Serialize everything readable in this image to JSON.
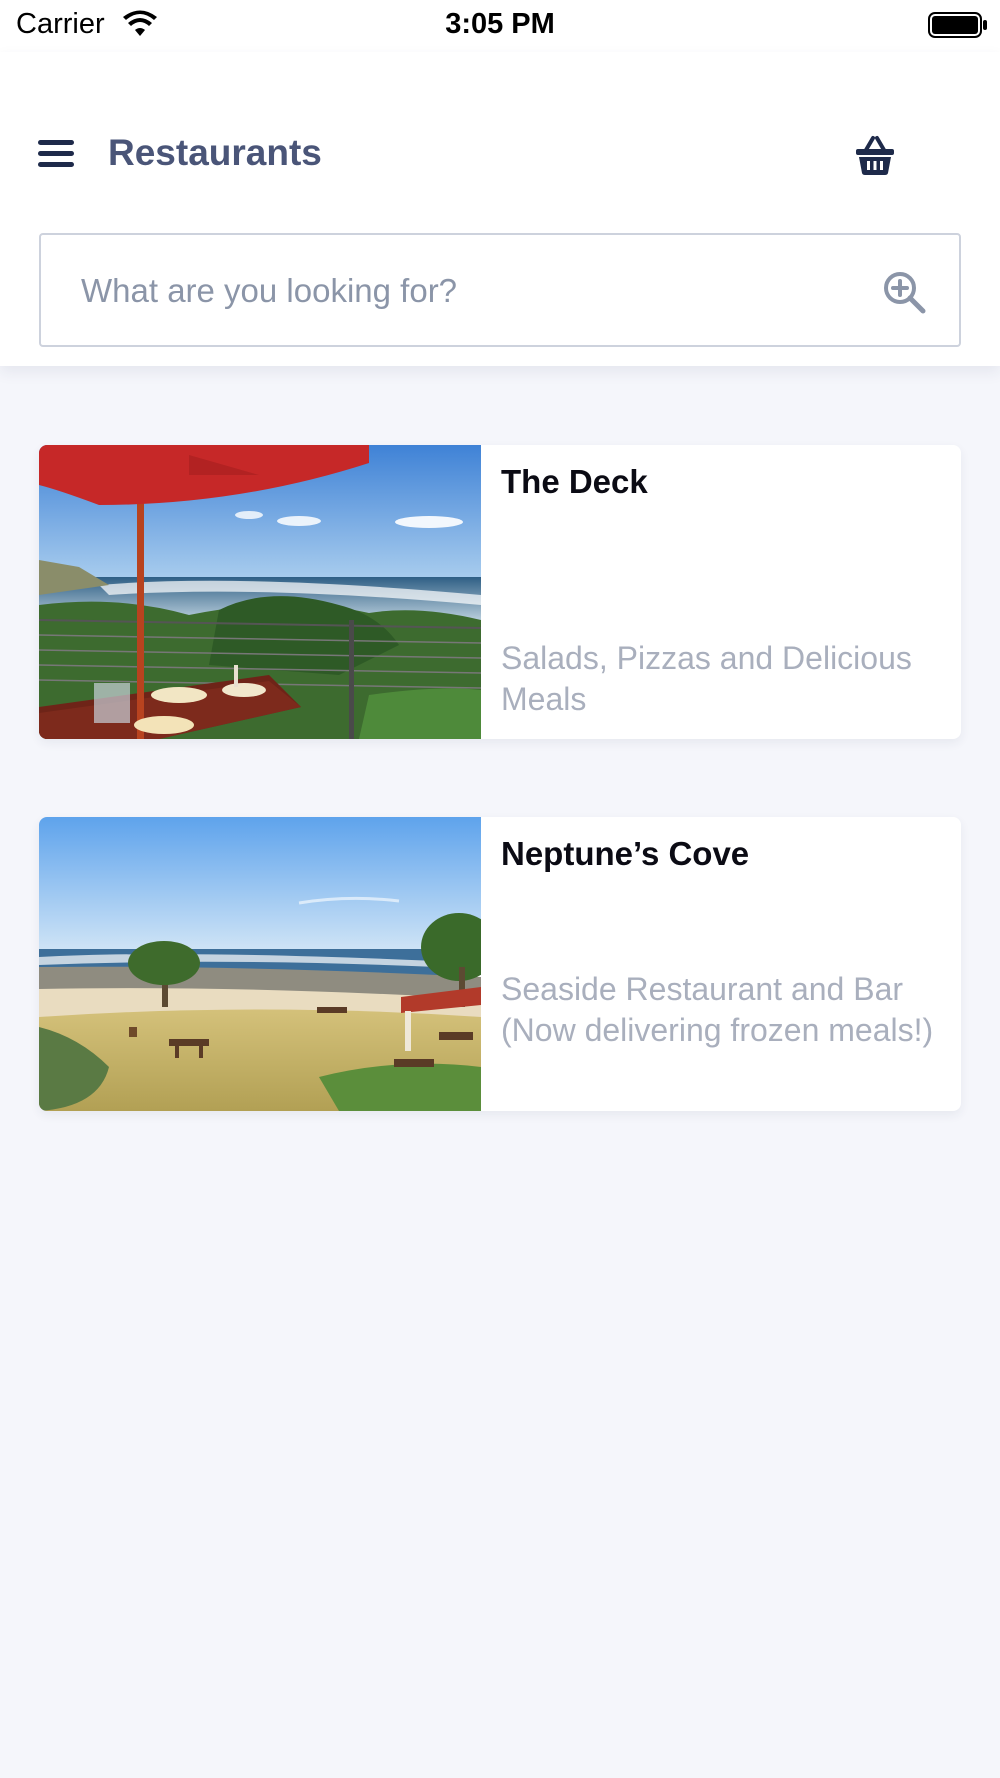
{
  "status_bar": {
    "carrier": "Carrier",
    "time": "3:05 PM"
  },
  "header": {
    "title": "Restaurants",
    "menu_icon": "hamburger-menu-icon",
    "basket_icon": "basket-icon"
  },
  "search": {
    "placeholder": "What are you looking for?",
    "value": "",
    "icon": "search-plus-icon"
  },
  "restaurants": [
    {
      "name": "The Deck",
      "description": "Salads, Pizzas and Delicious Meals",
      "image": "restaurant-photo-the-deck"
    },
    {
      "name": "Neptune’s Cove",
      "description": "Seaside Restaurant and Bar (Now delivering frozen meals!)",
      "image": "restaurant-photo-neptunes-cove"
    }
  ],
  "colors": {
    "background": "#f5f6fb",
    "title": "#4a5578",
    "icon_navy": "#1e2a4a",
    "description": "#a9afbd",
    "search_border": "#cdd2dd"
  }
}
